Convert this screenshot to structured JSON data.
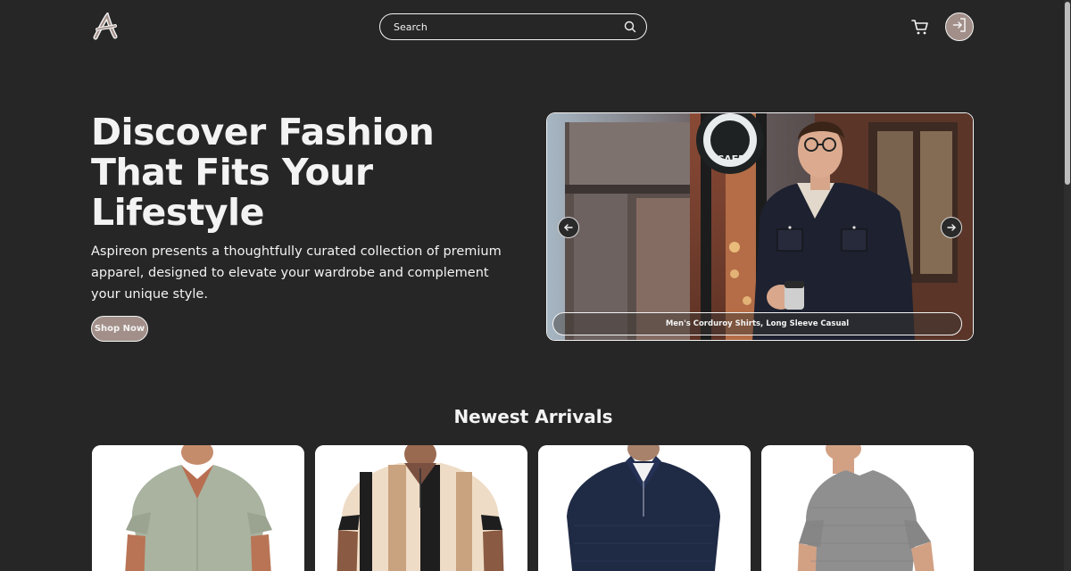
{
  "header": {
    "logo_letter": "A",
    "search_placeholder": "Search",
    "icons": [
      "logo-icon",
      "search-icon",
      "cart-icon",
      "login-icon"
    ]
  },
  "hero": {
    "title": "Discover Fashion That Fits Your Lifestyle",
    "description": "Aspireon presents a thoughtfully curated collection of premium apparel, designed to elevate your wardrobe and complement your unique style.",
    "cta_label": "Shop Now",
    "carousel": {
      "caption": "Men's Corduroy Shirts, Long Sleeve Casual",
      "sign_text": "CAFE"
    }
  },
  "arrivals": {
    "title": "Newest Arrivals",
    "products": [
      {
        "image": "sage green short sleeve shirt",
        "color": "#a9b3a0"
      },
      {
        "image": "striped knit polo",
        "color": "#e4c9ad"
      },
      {
        "image": "navy quarter-zip sweater",
        "color": "#1f2a44"
      },
      {
        "image": "grey textured t-shirt",
        "color": "#8f8f8f"
      }
    ]
  },
  "colors": {
    "background": "#262626",
    "accent": "#a28f89",
    "text": "#f3f3f3"
  }
}
